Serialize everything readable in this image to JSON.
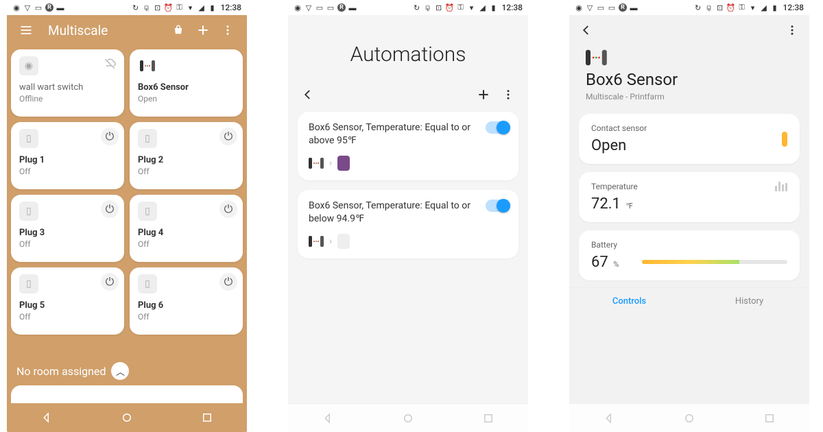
{
  "status_bar": {
    "time": "12:38"
  },
  "phone1": {
    "title": "Multiscale",
    "tiles": [
      {
        "name": "wall wart switch",
        "status": "Offline",
        "icon": "outlet",
        "corner": "cloud-off"
      },
      {
        "name": "Box6 Sensor",
        "status": "Open",
        "icon": "sensor",
        "corner": ""
      },
      {
        "name": "Plug 1",
        "status": "Off",
        "icon": "plug",
        "corner": "power"
      },
      {
        "name": "Plug 2",
        "status": "Off",
        "icon": "plug",
        "corner": "power"
      },
      {
        "name": "Plug 3",
        "status": "Off",
        "icon": "plug",
        "corner": "power"
      },
      {
        "name": "Plug 4",
        "status": "Off",
        "icon": "plug",
        "corner": "power"
      },
      {
        "name": "Plug 5",
        "status": "Off",
        "icon": "plug",
        "corner": "power"
      },
      {
        "name": "Plug 6",
        "status": "Off",
        "icon": "plug",
        "corner": "power"
      }
    ],
    "no_room": "No room assigned"
  },
  "phone2": {
    "title": "Automations",
    "automations": [
      {
        "title": "Box6 Sensor, Temperature: Equal to or above 95℉",
        "enabled": true
      },
      {
        "title": "Box6 Sensor, Temperature: Equal to or below 94.9℉",
        "enabled": true
      }
    ]
  },
  "phone3": {
    "device_name": "Box6 Sensor",
    "location": "Multiscale - Printfarm",
    "cards": {
      "contact": {
        "label": "Contact sensor",
        "value": "Open"
      },
      "temperature": {
        "label": "Temperature",
        "value": "72.1",
        "unit": "℉"
      },
      "battery": {
        "label": "Battery",
        "value": "67",
        "unit": "%",
        "percent": 67
      }
    },
    "tabs": {
      "controls": "Controls",
      "history": "History"
    }
  }
}
